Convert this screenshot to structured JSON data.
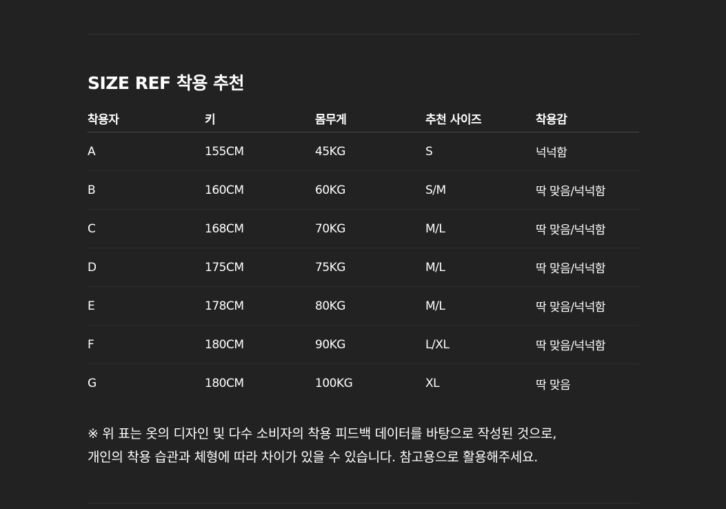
{
  "title": "SIZE REF 착용 추천",
  "table": {
    "headers": [
      "착용자",
      "키",
      "몸무게",
      "추천 사이즈",
      "착용감"
    ],
    "rows": [
      [
        "A",
        "155CM",
        "45KG",
        "S",
        "넉넉함"
      ],
      [
        "B",
        "160CM",
        "60KG",
        "S/M",
        "딱 맞음/넉넉함"
      ],
      [
        "C",
        "168CM",
        "70KG",
        "M/L",
        "딱 맞음/넉넉함"
      ],
      [
        "D",
        "175CM",
        "75KG",
        "M/L",
        "딱 맞음/넉넉함"
      ],
      [
        "E",
        "178CM",
        "80KG",
        "M/L",
        "딱 맞음/넉넉함"
      ],
      [
        "F",
        "180CM",
        "90KG",
        "L/XL",
        "딱 맞음/넉넉함"
      ],
      [
        "G",
        "180CM",
        "100KG",
        "XL",
        "딱 맞음"
      ]
    ]
  },
  "note": {
    "line1": "※ 위 표는 옷의 디자인 및 다수 소비자의 착용 피드백 데이터를 바탕으로 작성된 것으로,",
    "line2": "개인의 착용 습관과 체형에 따라 차이가 있을 수 있습니다. 참고용으로 활용해주세요."
  }
}
